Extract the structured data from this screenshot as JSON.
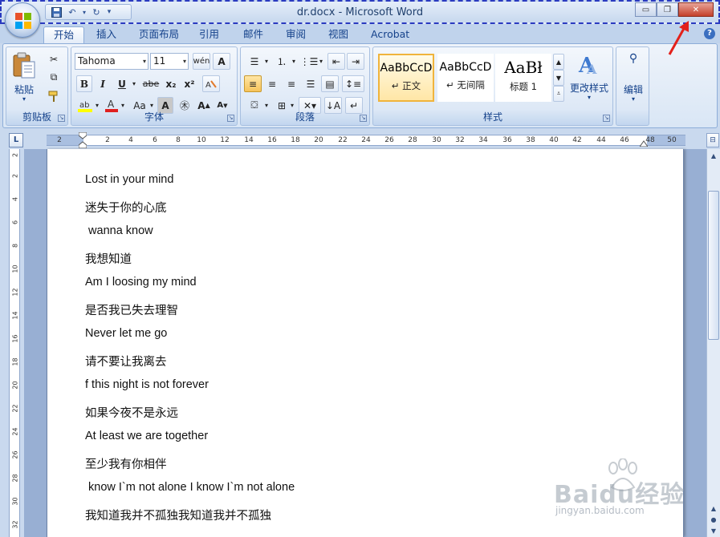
{
  "window": {
    "title": "dr.docx - Microsoft Word",
    "controls": [
      "minimize",
      "restore",
      "close"
    ]
  },
  "qat": {
    "items": [
      {
        "name": "save-icon",
        "glyph": "▣"
      },
      {
        "name": "undo-icon",
        "glyph": "↶"
      },
      {
        "name": "redo-icon",
        "glyph": "↻"
      }
    ],
    "customize_glyph": "▾"
  },
  "tabs": [
    "开始",
    "插入",
    "页面布局",
    "引用",
    "邮件",
    "审阅",
    "视图",
    "Acrobat"
  ],
  "active_tab": "开始",
  "ribbon": {
    "clipboard": {
      "label": "剪贴板",
      "paste": "粘贴"
    },
    "font": {
      "label": "字体",
      "font_name": "Tahoma",
      "font_size": "11",
      "row2": [
        "B",
        "I",
        "U",
        "abe",
        "x₂",
        "x²"
      ],
      "row3": [
        "Aa"
      ]
    },
    "paragraph": {
      "label": "段落"
    },
    "styles": {
      "label": "样式",
      "tiles": [
        {
          "sample": "AaBbCcD",
          "name": "↵ 正文"
        },
        {
          "sample": "AaBbCcD",
          "name": "↵ 无间隔"
        },
        {
          "sample": "AaBł",
          "name": "标题 1"
        }
      ],
      "change_styles": "更改样式"
    },
    "editing": {
      "label": "编辑"
    }
  },
  "ruler": {
    "h_ticks": [
      "2",
      "2",
      "4",
      "6",
      "8",
      "10",
      "12",
      "14",
      "16",
      "18",
      "20",
      "22",
      "24",
      "26",
      "28",
      "30",
      "32",
      "34",
      "36",
      "38",
      "40",
      "42",
      "44",
      "46",
      "48",
      "50"
    ],
    "v_ticks": [
      "2",
      "2",
      "4",
      "6",
      "8",
      "10",
      "12",
      "14",
      "16",
      "18",
      "20",
      "22",
      "24",
      "26",
      "28",
      "30",
      "32"
    ]
  },
  "document": {
    "lines": [
      "Lost in your mind",
      "迷失于你的心底",
      " wanna know",
      "我想知道",
      "Am I loosing my mind",
      "是否我已失去理智",
      "Never let me go",
      "请不要让我离去",
      "f this night is not forever",
      "如果今夜不是永远",
      "At least we are together",
      "至少我有你相伴",
      " know I`m not alone I know I`m not alone",
      "我知道我并不孤独我知道我并不孤独"
    ]
  },
  "watermark": {
    "brand": "Baidu经验",
    "url": "jingyan.baidu.com"
  }
}
